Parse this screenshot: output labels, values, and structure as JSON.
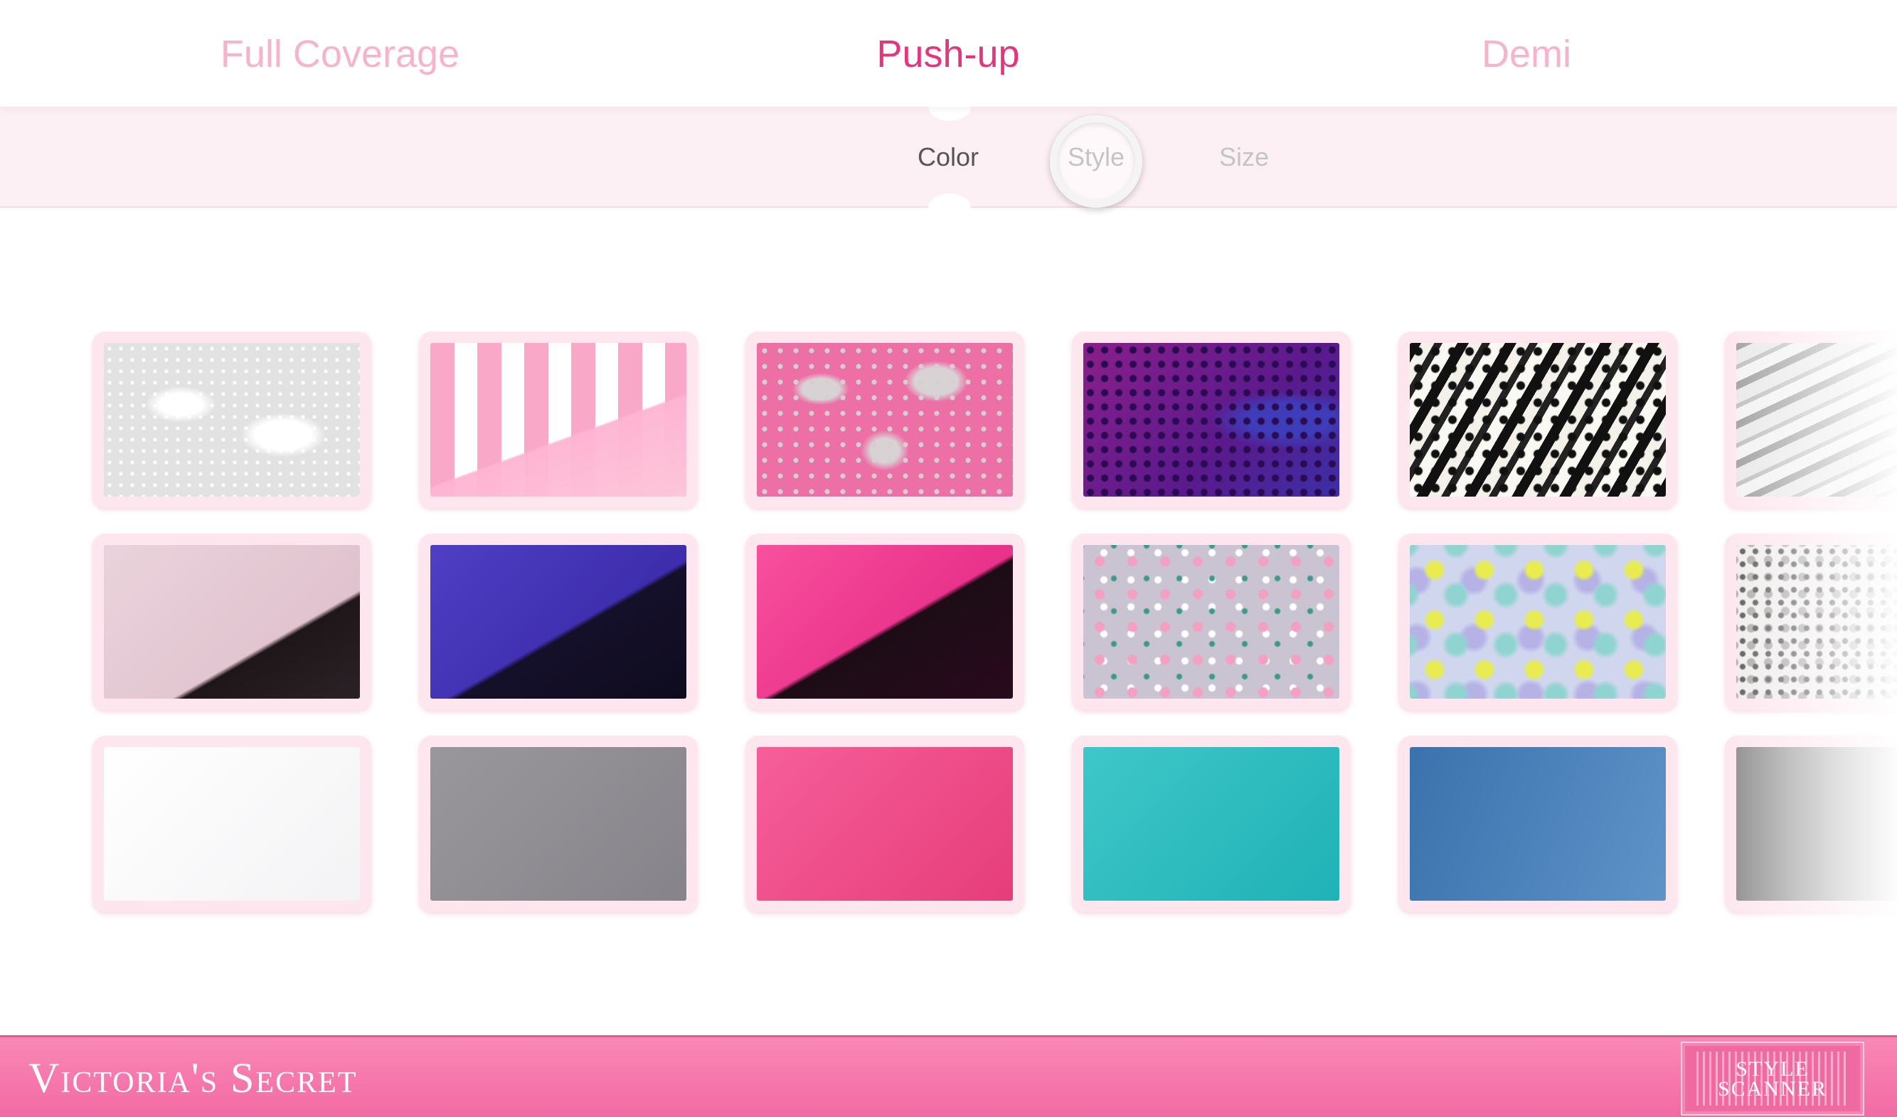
{
  "category_tabs": [
    {
      "label": "Full Coverage",
      "active": false
    },
    {
      "label": "Push-up",
      "active": true
    },
    {
      "label": "Demi",
      "active": false
    }
  ],
  "sub_tabs": [
    {
      "label": "Color",
      "active": true
    },
    {
      "label": "Style",
      "active": false
    },
    {
      "label": "Size",
      "active": false
    }
  ],
  "colors": {
    "active_tab": "#e5357f",
    "inactive_tab": "#f7b3cc",
    "footer_pink": "#f579ac",
    "tile_frame": "#fde6ee"
  },
  "swatches": [
    [
      "white-lace",
      "pink-stripe",
      "pink-grey-lace",
      "purple-lace",
      "black-white-paisley",
      "silver-zebra"
    ],
    [
      "blush-black-lace",
      "purple-black-lace",
      "hot-pink-black-lace",
      "lavender-floral",
      "pastel-floral",
      "leopard-print"
    ],
    [
      "white-solid",
      "grey-solid",
      "pink-solid",
      "teal-solid",
      "blue-solid",
      "silver-solid"
    ]
  ],
  "footer": {
    "brand": "Victoria's Secret",
    "scanner_line1": "STYLE",
    "scanner_line2": "SCANNER"
  }
}
